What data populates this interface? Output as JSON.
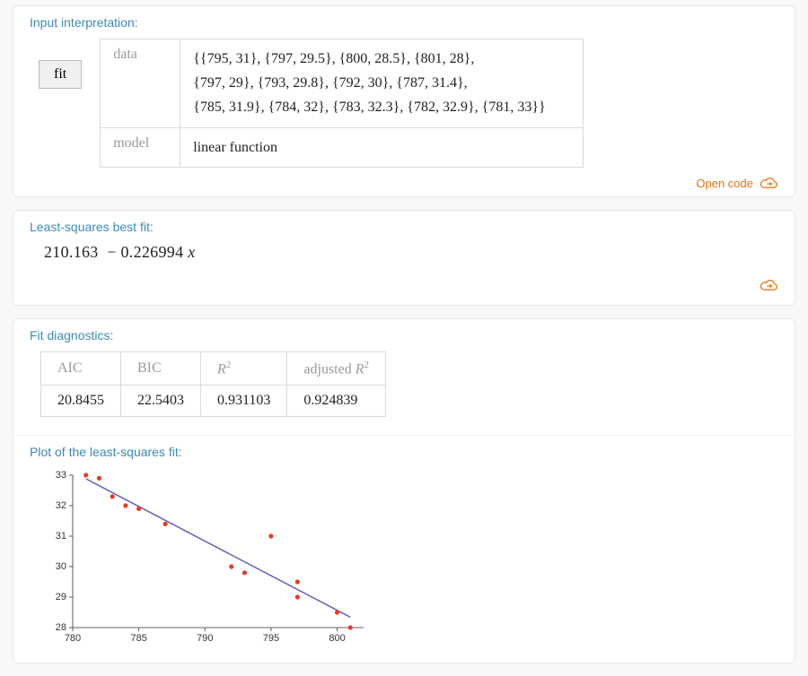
{
  "input_interpretation": {
    "title": "Input interpretation:",
    "button": "fit",
    "rows": [
      {
        "label": "data",
        "value": "{{795, 31}, {797, 29.5}, {800, 28.5}, {801, 28},\n{797, 29}, {793, 29.8}, {792, 30}, {787, 31.4},\n{785, 31.9}, {784, 32}, {783, 32.3}, {782, 32.9}, {781, 33}}"
      },
      {
        "label": "model",
        "value": "linear function"
      }
    ],
    "open_code": "Open code"
  },
  "best_fit": {
    "title": "Least-squares best fit:",
    "intercept": "210.163",
    "slope": "0.226994",
    "var": "x"
  },
  "diagnostics": {
    "title": "Fit diagnostics:",
    "headers": [
      "AIC",
      "BIC",
      "R²",
      "adjusted R²"
    ],
    "values": [
      "20.8455",
      "22.5403",
      "0.931103",
      "0.924839"
    ]
  },
  "plot": {
    "title": "Plot of the least-squares fit:"
  },
  "chart_data": {
    "type": "scatter+line",
    "points": [
      {
        "x": 795,
        "y": 31
      },
      {
        "x": 797,
        "y": 29.5
      },
      {
        "x": 800,
        "y": 28.5
      },
      {
        "x": 801,
        "y": 28
      },
      {
        "x": 797,
        "y": 29
      },
      {
        "x": 793,
        "y": 29.8
      },
      {
        "x": 792,
        "y": 30
      },
      {
        "x": 787,
        "y": 31.4
      },
      {
        "x": 785,
        "y": 31.9
      },
      {
        "x": 784,
        "y": 32
      },
      {
        "x": 783,
        "y": 32.3
      },
      {
        "x": 782,
        "y": 32.9
      },
      {
        "x": 781,
        "y": 33
      }
    ],
    "fit_line": {
      "intercept": 210.163,
      "slope": -0.226994
    },
    "xlim": [
      780,
      802
    ],
    "ylim": [
      28,
      33
    ],
    "xticks": [
      780,
      785,
      790,
      795,
      800
    ],
    "yticks": [
      28,
      29,
      30,
      31,
      32,
      33
    ]
  }
}
